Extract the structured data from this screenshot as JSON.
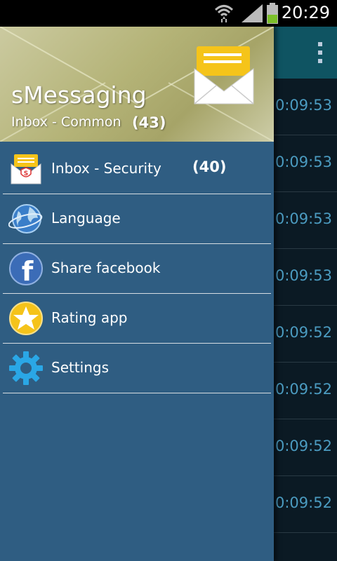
{
  "status_bar": {
    "time": "20:29",
    "icons": [
      "wifi-icon",
      "signal-icon",
      "battery-icon"
    ]
  },
  "background": {
    "timestamps": [
      "0:09:53",
      "0:09:53",
      "0:09:53",
      "0:09:53",
      "0:09:52",
      "0:09:52",
      "0:09:52",
      "0:09:52"
    ]
  },
  "drawer": {
    "header": {
      "title": "sMessaging",
      "subtitle": "Inbox - Common",
      "count": "(43)"
    },
    "items": [
      {
        "label": "Inbox - Security",
        "count": "(40)",
        "icon": "security-inbox-icon"
      },
      {
        "label": "Language",
        "icon": "globe-icon"
      },
      {
        "label": "Share facebook",
        "icon": "facebook-icon"
      },
      {
        "label": "Rating app",
        "icon": "star-icon"
      },
      {
        "label": "Settings",
        "icon": "gear-icon"
      }
    ]
  },
  "colors": {
    "drawer_bg": "#2f5d82",
    "actionbar": "#0f5462",
    "timestamp": "#4b9bc0",
    "envelope_yellow": "#f5c41a"
  }
}
